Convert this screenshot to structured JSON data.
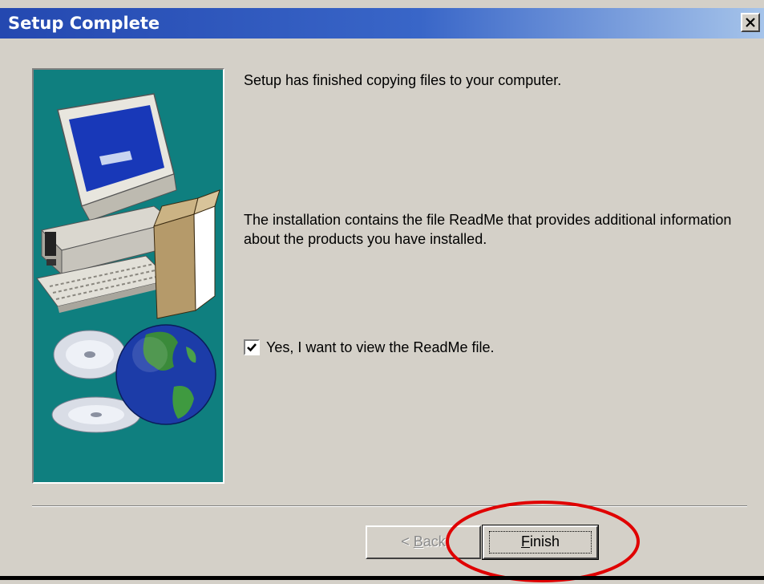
{
  "window": {
    "title": "Setup Complete",
    "close_icon": "close-icon"
  },
  "content": {
    "message_1": "Setup has finished copying files to your computer.",
    "message_2": "The installation contains the file ReadMe that provides additional information about the products you have installed.",
    "checkbox_label": "Yes, I want to view the ReadMe file.",
    "checkbox_checked": true
  },
  "buttons": {
    "back_label": "< Back",
    "finish_label": "Finish",
    "back_enabled": false
  },
  "graphic": {
    "icon": "computer-install-illustration",
    "panel_color": "#0f7f7f"
  },
  "annotation": {
    "color": "#e00000",
    "target": "finish-button"
  }
}
